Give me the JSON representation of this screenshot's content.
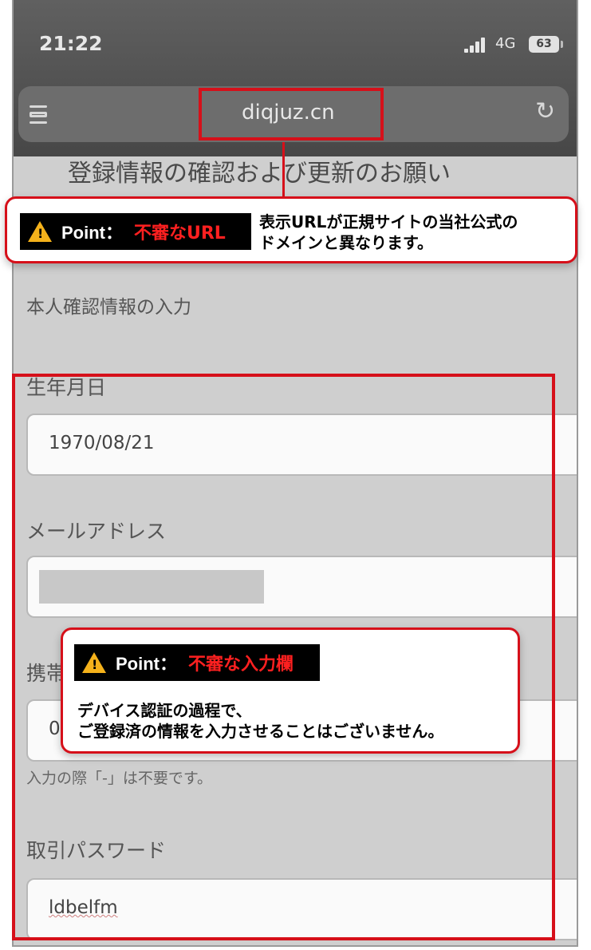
{
  "status": {
    "time": "21:22",
    "network": "4G",
    "battery": "63"
  },
  "browser": {
    "url": "diqjuz.cn"
  },
  "page": {
    "title": "登録情報の確認および更新のお願い",
    "section_title": "本人確認情報の入力",
    "birthdate_label": "生年月日",
    "birthdate_value": "1970/08/21",
    "email_label": "メールアドレス",
    "phone_label": "携帯",
    "phone_value": "0",
    "phone_hint": "入力の際「-」は不要です。",
    "password_label": "取引パスワード",
    "password_value": "ldbelfm"
  },
  "callout_url": {
    "point": "Point：",
    "tag": "不審なURL",
    "text_line1": "表示URLが正規サイトの当社公式の",
    "text_line2": "ドメインと異なります。"
  },
  "callout_form": {
    "point": "Point：",
    "tag": "不審な入力欄",
    "text_line1": "デバイス認証の過程で、",
    "text_line2": "ご登録済の情報を入力させることはございません。"
  },
  "colors": {
    "highlight": "#d6101a",
    "warning": "#f5b21b"
  }
}
